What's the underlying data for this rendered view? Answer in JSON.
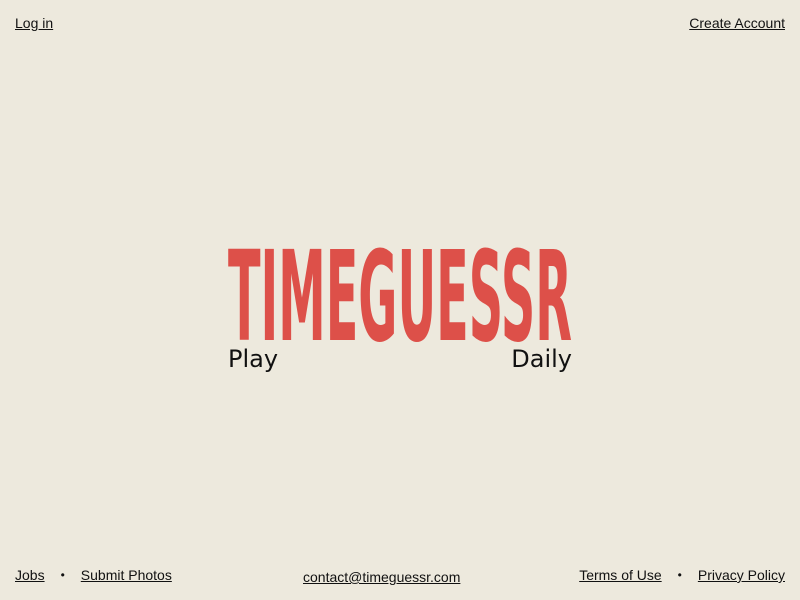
{
  "header": {
    "login_label": "Log in",
    "create_account_label": "Create Account"
  },
  "logo": {
    "wordmark": "TIMEGUESSR",
    "color": "#dd5049",
    "tagline_left": "Play",
    "tagline_right": "Daily"
  },
  "footer": {
    "jobs_label": "Jobs",
    "separator": "•",
    "submit_photos_label": "Submit Photos",
    "contact_email": "contact@timeguessr.com",
    "terms_label": "Terms of Use",
    "privacy_label": "Privacy Policy"
  },
  "colors": {
    "background": "#ede9dd",
    "text": "#111111",
    "accent": "#dd5049"
  }
}
